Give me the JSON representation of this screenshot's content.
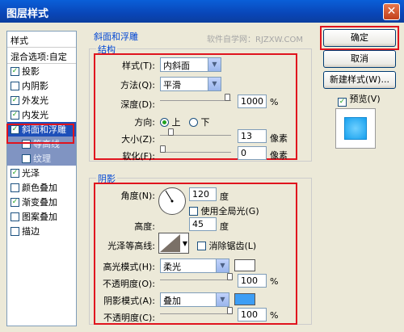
{
  "window": {
    "title": "图层样式"
  },
  "styles_panel": {
    "header": "样式",
    "blend_options": "混合选项:自定",
    "items": [
      {
        "label": "投影",
        "checked": true
      },
      {
        "label": "内阴影",
        "checked": false
      },
      {
        "label": "外发光",
        "checked": true
      },
      {
        "label": "内发光",
        "checked": true
      },
      {
        "label": "斜面和浮雕",
        "checked": true
      },
      {
        "label": "等高线",
        "checked": false
      },
      {
        "label": "纹理",
        "checked": false
      },
      {
        "label": "光泽",
        "checked": true
      },
      {
        "label": "颜色叠加",
        "checked": false
      },
      {
        "label": "渐变叠加",
        "checked": true
      },
      {
        "label": "图案叠加",
        "checked": false
      },
      {
        "label": "描边",
        "checked": false
      }
    ]
  },
  "main": {
    "section_title": "斜面和浮雕",
    "watermark": "软件自学网：RJZXW.COM",
    "structure": {
      "title": "结构",
      "style_label": "样式(T):",
      "style_value": "内斜面",
      "technique_label": "方法(Q):",
      "technique_value": "平滑",
      "depth_label": "深度(D):",
      "depth_value": "1000",
      "depth_unit": "%",
      "direction_label": "方向:",
      "direction_up": "上",
      "direction_down": "下",
      "size_label": "大小(Z):",
      "size_value": "13",
      "size_unit": "像素",
      "soften_label": "软化(F):",
      "soften_value": "0",
      "soften_unit": "像素"
    },
    "shading": {
      "title": "阴影",
      "angle_label": "角度(N):",
      "angle_value": "120",
      "angle_unit": "度",
      "global_light_label": "使用全局光(G)",
      "altitude_label": "高度:",
      "altitude_value": "45",
      "altitude_unit": "度",
      "gloss_contour_label": "光泽等高线:",
      "anti_aliased_label": "消除锯齿(L)",
      "highlight_mode_label": "高光模式(H):",
      "highlight_mode_value": "柔光",
      "highlight_opacity_label": "不透明度(O):",
      "highlight_opacity_value": "100",
      "highlight_opacity_unit": "%",
      "shadow_mode_label": "阴影模式(A):",
      "shadow_mode_value": "叠加",
      "shadow_opacity_label": "不透明度(C):",
      "shadow_opacity_value": "100",
      "shadow_opacity_unit": "%",
      "highlight_color": "#FFFFFF",
      "shadow_color": "#3D9EF5"
    }
  },
  "buttons": {
    "ok": "确定",
    "cancel": "取消",
    "new_style": "新建样式(W)...",
    "preview_label": "预览(V)"
  },
  "colors": {
    "accent": "#0A5FD8",
    "highlight_box": "#E0141E",
    "preview": "#2DA8F2"
  }
}
